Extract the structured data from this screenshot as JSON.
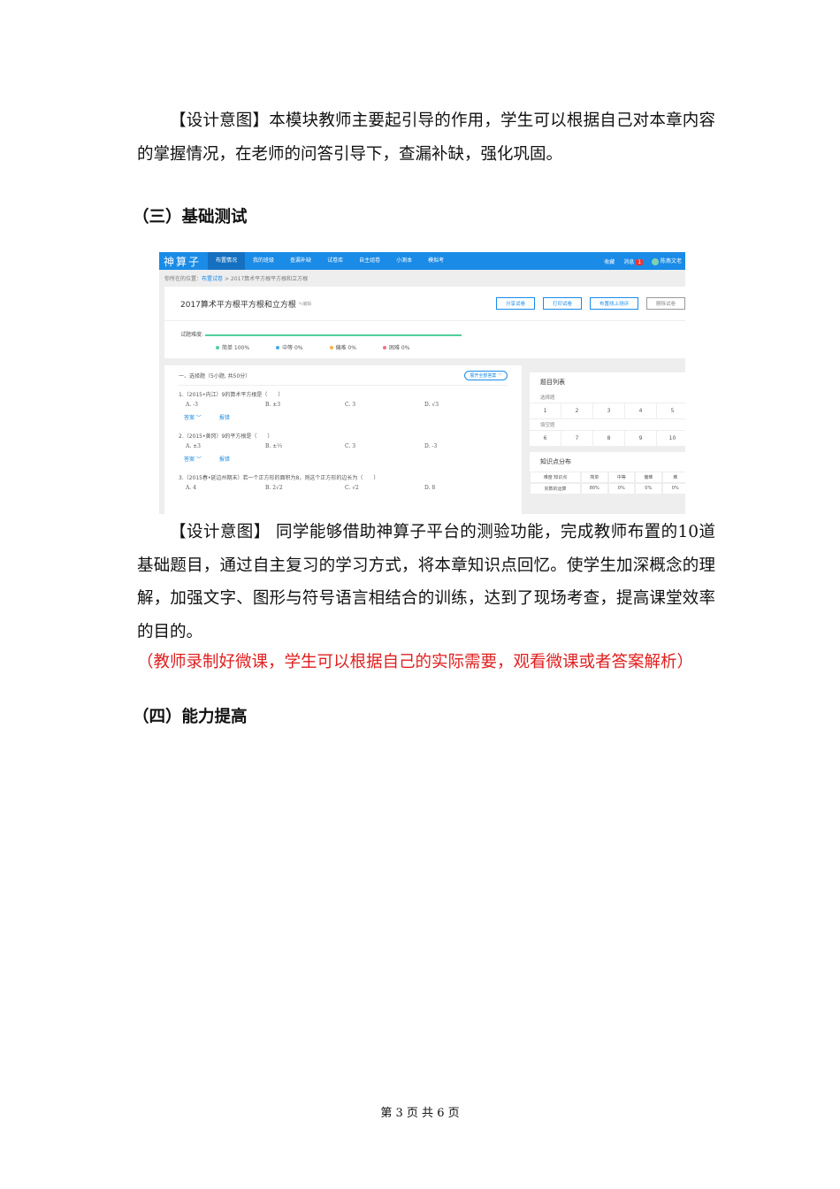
{
  "paragraphs": {
    "p1": "【设计意图】本模块教师主要起引导的作用，学生可以根据自己对本章内容的掌握情况，在老师的问答引导下，查漏补缺，强化巩固。",
    "h3": "（三）基础测试",
    "p2": "【设计意图】 同学能够借助神算子平台的测验功能，完成教师布置的10道基础题目，通过自主复习的学习方式，将本章知识点回忆。使学生加深概念的理解，加强文字、图形与符号语言相结合的训练，达到了现场考查，提高课堂效率的目的。",
    "red": "（教师录制好微课，学生可以根据自己的实际需要，观看微课或者答案解析）",
    "h4": "（四）能力提高"
  },
  "screenshot": {
    "logo": "神算子",
    "nav": [
      "布置情况",
      "我的班级",
      "查漏补缺",
      "试卷库",
      "自主组卷",
      "小测本",
      "模拟考"
    ],
    "nav_right": {
      "fav": "收藏",
      "msg": "消息",
      "msg_count": "1",
      "user": "陈燕文老"
    },
    "crumb": {
      "prefix": "你所在的位置：",
      "link": "布置试卷",
      "rest": " > 2017算术平方根平方根和立方根"
    },
    "title": "2017算术平方根平方根和立方根",
    "edit": "✎编辑",
    "buttons": [
      "分享试卷",
      "打印试卷",
      "布置线上测评",
      "删除试卷"
    ],
    "difficulty_label": "试题难度:",
    "legend": [
      {
        "label": "简单 100%",
        "color": "#4fcf9c"
      },
      {
        "label": "中等 0%",
        "color": "#4aa8e8"
      },
      {
        "label": "偏难 0%",
        "color": "#f5b04a"
      },
      {
        "label": "困难 0%",
        "color": "#f07080"
      }
    ],
    "section": "一、选择题（5小题, 共50分）",
    "expand": "展开全部答案 ﹀",
    "questions": [
      {
        "q": "1.（2015•内江）9的算术平方根是（　　）",
        "opts": [
          "A. -3",
          "B. ±3",
          "C. 3",
          "D. √3"
        ]
      },
      {
        "q": "2.（2015•黄冈）9的平方根是（　　）",
        "opts": [
          "A. ±3",
          "B. ±⅓",
          "C. 3",
          "D. -3"
        ]
      },
      {
        "q": "3.（2015春•延边州期末）若一个正方形的面积为8，则这个正方形的边长为（　　）",
        "opts": [
          "A. 4",
          "B. 2√2",
          "C. √2",
          "D. 8"
        ]
      }
    ],
    "answer": "答案 ﹀",
    "report": "报错",
    "list_title": "题目列表",
    "choice": "选择题",
    "fill": "填空题",
    "nums1": [
      "1",
      "2",
      "3",
      "4",
      "5"
    ],
    "nums2": [
      "6",
      "7",
      "8",
      "9",
      "10"
    ],
    "kp_title": "知识点分布",
    "kp_head": [
      "难度 知识点",
      "简单",
      "中等",
      "偏难",
      "难"
    ],
    "kp_row": [
      "实数的运算",
      "80%",
      "0%",
      "0%",
      "0%"
    ]
  },
  "footer": "第 3 页 共 6 页"
}
